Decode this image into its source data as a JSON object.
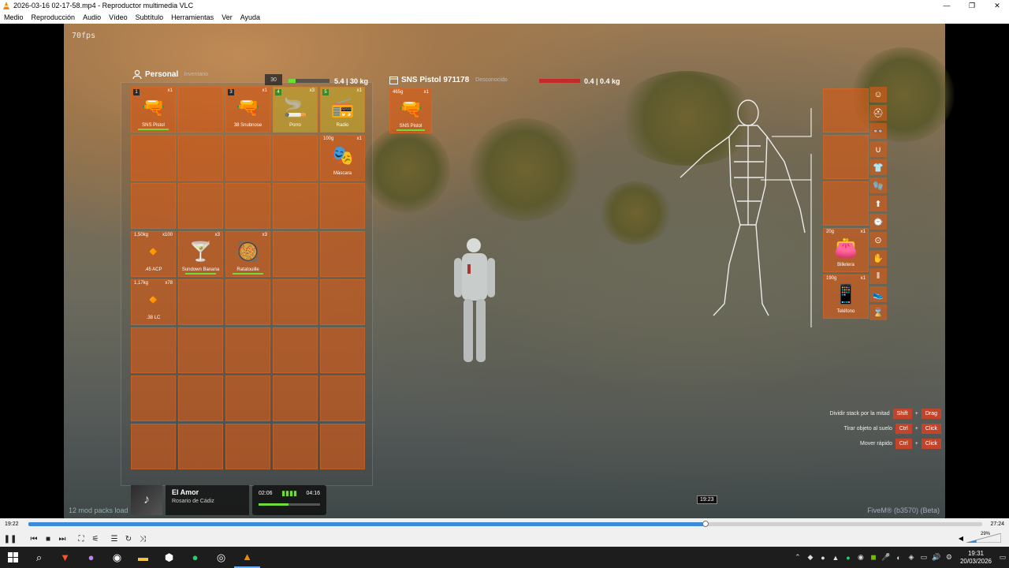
{
  "window": {
    "title": "2026-03-16 02-17-58.mp4 - Reproductor multimedia VLC",
    "minimize": "—",
    "maximize": "❐",
    "close": "✕"
  },
  "menu": [
    "Medio",
    "Reproducción",
    "Audio",
    "Vídeo",
    "Subtítulo",
    "Herramientas",
    "Ver",
    "Ayuda"
  ],
  "overlay": {
    "fps": "70fps",
    "mod_packs": "12 mod packs load",
    "fivem": "FiveM® (b3570) (Beta)",
    "seek_tooltip": "19:23"
  },
  "inventory": {
    "title": "Personal",
    "subtitle": "Inventario",
    "slots_label": "30",
    "weight": "5.4 | 30 kg",
    "weight_fraction": 0.18,
    "items": [
      {
        "slot": 0,
        "num": "1",
        "qty": "x1",
        "label": "SNS Pistol",
        "icon": "🔫",
        "dur": true
      },
      {
        "slot": 2,
        "num": "3",
        "qty": "x1",
        "label": "38 Snubnose",
        "icon": "🔫",
        "dur": false
      },
      {
        "slot": 3,
        "num": "4",
        "qty": "x3",
        "label": "Porro",
        "icon": "🚬",
        "dur": false,
        "sel": true
      },
      {
        "slot": 4,
        "num": "5",
        "qty": "x1",
        "label": "Radio",
        "icon": "📻",
        "dur": false,
        "sel": true
      },
      {
        "slot": 9,
        "wt": "100g",
        "qty": "x1",
        "label": "Máscara",
        "icon": "🎭",
        "dur": false
      },
      {
        "slot": 15,
        "wt": "1,50kg",
        "qty": "x100",
        "label": ".45 ACP",
        "icon": "🔸",
        "dur": false
      },
      {
        "slot": 16,
        "qty": "x3",
        "label": "Sundown Banana",
        "icon": "🍸",
        "dur": true
      },
      {
        "slot": 17,
        "qty": "x3",
        "label": "Ratatouille",
        "icon": "🥘",
        "dur": true
      },
      {
        "slot": 20,
        "wt": "1,17kg",
        "qty": "x78",
        "label": ".38 LC",
        "icon": "🔸",
        "dur": false
      }
    ]
  },
  "secondary": {
    "title": "SNS Pistol 971178",
    "subtitle": "Desconocido",
    "weight": "0.4 | 0.4 kg",
    "weight_fraction": 1.0,
    "item": {
      "wt": "465g",
      "qty": "x1",
      "label": "SNS Pistol",
      "icon": "🔫"
    }
  },
  "equipment": [
    {
      "label": "",
      "icon": ""
    },
    {
      "label": "",
      "icon": ""
    },
    {
      "label": "",
      "icon": ""
    },
    {
      "wt": "20g",
      "qty": "x1",
      "label": "Billetera",
      "icon": "👛"
    },
    {
      "wt": "190g",
      "qty": "x1",
      "label": "Teléfono",
      "icon": "📱"
    }
  ],
  "equip_icons": [
    "☺",
    "⛑",
    "👓",
    "∪",
    "👕",
    "🧤",
    "⬆",
    "⌚",
    "⊙",
    "✋",
    "‖",
    "👟",
    "⌛"
  ],
  "hints": [
    {
      "text": "Dividir stack por la mitad",
      "k1": "Shift",
      "k2": "Drag"
    },
    {
      "text": "Tirar objeto al suelo",
      "k1": "Ctrl",
      "k2": "Click"
    },
    {
      "text": "Mover rápido",
      "k1": "Ctrl",
      "k2": "Click"
    }
  ],
  "music": {
    "title": "El Amor",
    "artist": "Rosario de Cádiz",
    "elapsed": "02:06",
    "total": "04:16",
    "progress": 0.49
  },
  "player": {
    "current_time": "19:22",
    "total_time": "27:24",
    "progress": 0.71,
    "volume": "29%"
  },
  "taskbar": {
    "time": "19:31",
    "date": "20/03/2026"
  }
}
